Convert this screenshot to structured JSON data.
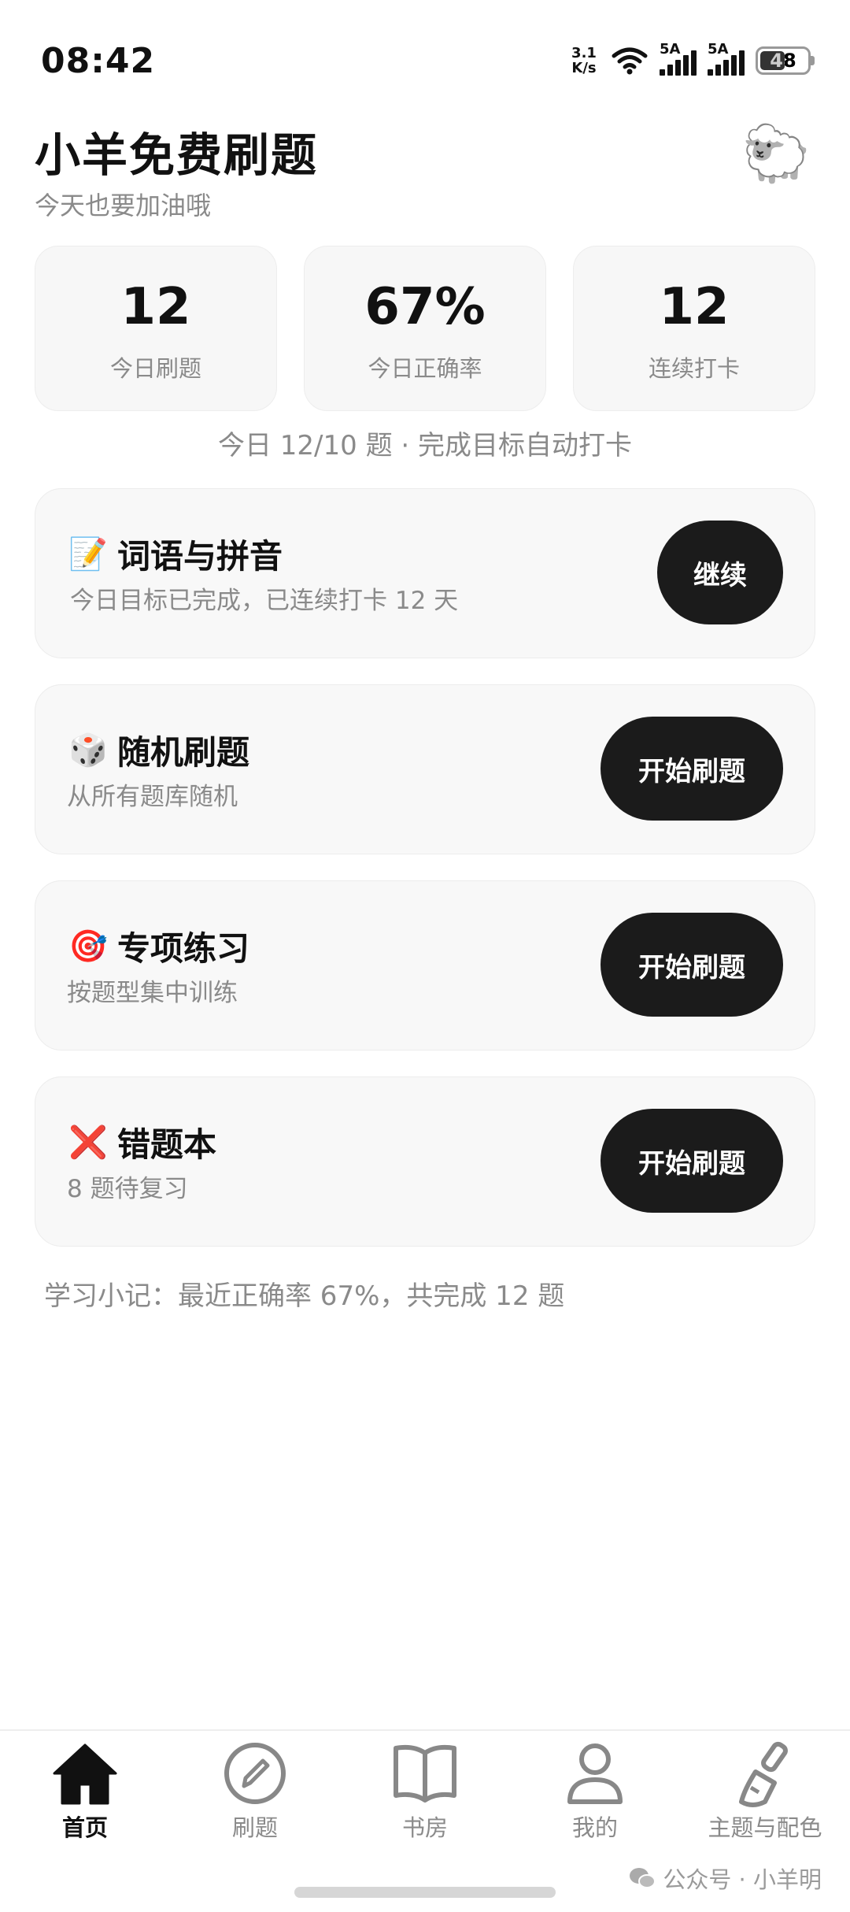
{
  "status_bar": {
    "time": "08:42",
    "net_speed_value": "3.1",
    "net_speed_unit": "K/s",
    "sim1_label": "5A",
    "sim2_label": "5A",
    "battery": "48"
  },
  "header": {
    "title": "小羊免费刷题",
    "subtitle": "今天也要加油哦",
    "avatar_icon": "sheep-icon"
  },
  "stats": [
    {
      "value": "12",
      "label": "今日刷题"
    },
    {
      "value": "67%",
      "label": "今日正确率"
    },
    {
      "value": "12",
      "label": "连续打卡"
    }
  ],
  "goal_line": "今日 12/10 题 · 完成目标自动打卡",
  "cards": [
    {
      "emoji": "📝",
      "icon": "memo-icon",
      "title": "词语与拼音",
      "desc": "今日目标已完成，已连续打卡 12 天",
      "button": "继续"
    },
    {
      "emoji": "🎲",
      "icon": "dice-icon",
      "title": "随机刷题",
      "desc": "从所有题库随机",
      "button": "开始刷题"
    },
    {
      "emoji": "🎯",
      "icon": "target-icon",
      "title": "专项练习",
      "desc": "按题型集中训练",
      "button": "开始刷题"
    },
    {
      "emoji": "❌",
      "icon": "cross-icon",
      "title": "错题本",
      "desc": "8 题待复习",
      "button": "开始刷题"
    }
  ],
  "note": "学习小记：最近正确率 67%，共完成 12 题",
  "nav": [
    {
      "label": "首页",
      "icon": "home-icon",
      "active": true
    },
    {
      "label": "刷题",
      "icon": "pencil-circle-icon",
      "active": false
    },
    {
      "label": "书房",
      "icon": "book-icon",
      "active": false
    },
    {
      "label": "我的",
      "icon": "user-icon",
      "active": false
    },
    {
      "label": "主题与配色",
      "icon": "brush-icon",
      "active": false
    }
  ],
  "watermark": "公众号 · 小羊明",
  "colors": {
    "accent": "#1b1b1b",
    "muted_text": "#8a8a8a",
    "card_bg": "#f8f8f8"
  }
}
